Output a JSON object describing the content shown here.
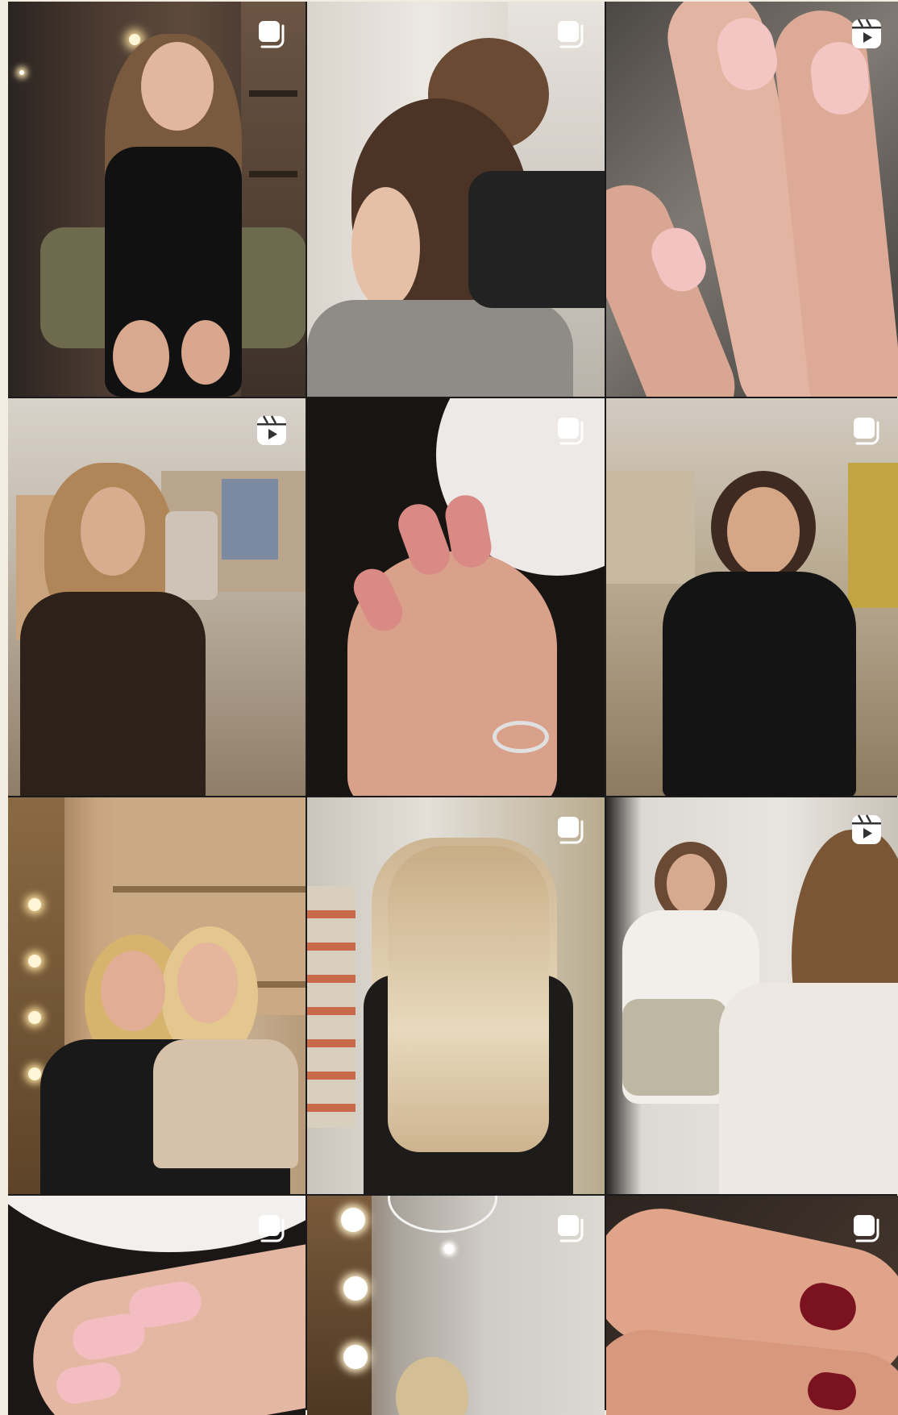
{
  "grid": {
    "tiles": [
      {
        "id": "post-1",
        "badge": "carousel-icon",
        "subject": "woman-long-wavy-hair-black-dress"
      },
      {
        "id": "post-2",
        "badge": "carousel-icon",
        "subject": "messy-bun-hairstyle"
      },
      {
        "id": "post-3",
        "badge": "reel-icon",
        "subject": "natural-pink-manicure"
      },
      {
        "id": "post-4",
        "badge": "reel-icon",
        "subject": "wavy-bob-mirror-selfie"
      },
      {
        "id": "post-5",
        "badge": "carousel-icon",
        "subject": "pink-almond-nails-ring"
      },
      {
        "id": "post-6",
        "badge": "carousel-icon",
        "subject": "short-bob-black-blazer"
      },
      {
        "id": "post-7",
        "badge": "none",
        "subject": "two-blondes-mirror"
      },
      {
        "id": "post-8",
        "badge": "carousel-icon",
        "subject": "long-straight-blonde-hair"
      },
      {
        "id": "post-9",
        "badge": "reel-icon",
        "subject": "salon-client-white-outfit"
      },
      {
        "id": "post-10",
        "badge": "carousel-icon",
        "subject": "pale-pink-nails"
      },
      {
        "id": "post-11",
        "badge": "carousel-icon",
        "subject": "mirror-lights-blonde"
      },
      {
        "id": "post-12",
        "badge": "carousel-icon",
        "subject": "burgundy-nails"
      }
    ]
  },
  "colors": {
    "page_background": "#f3ece0",
    "grid_gap": "#1a1a1a",
    "badge_white": "#ffffff"
  }
}
